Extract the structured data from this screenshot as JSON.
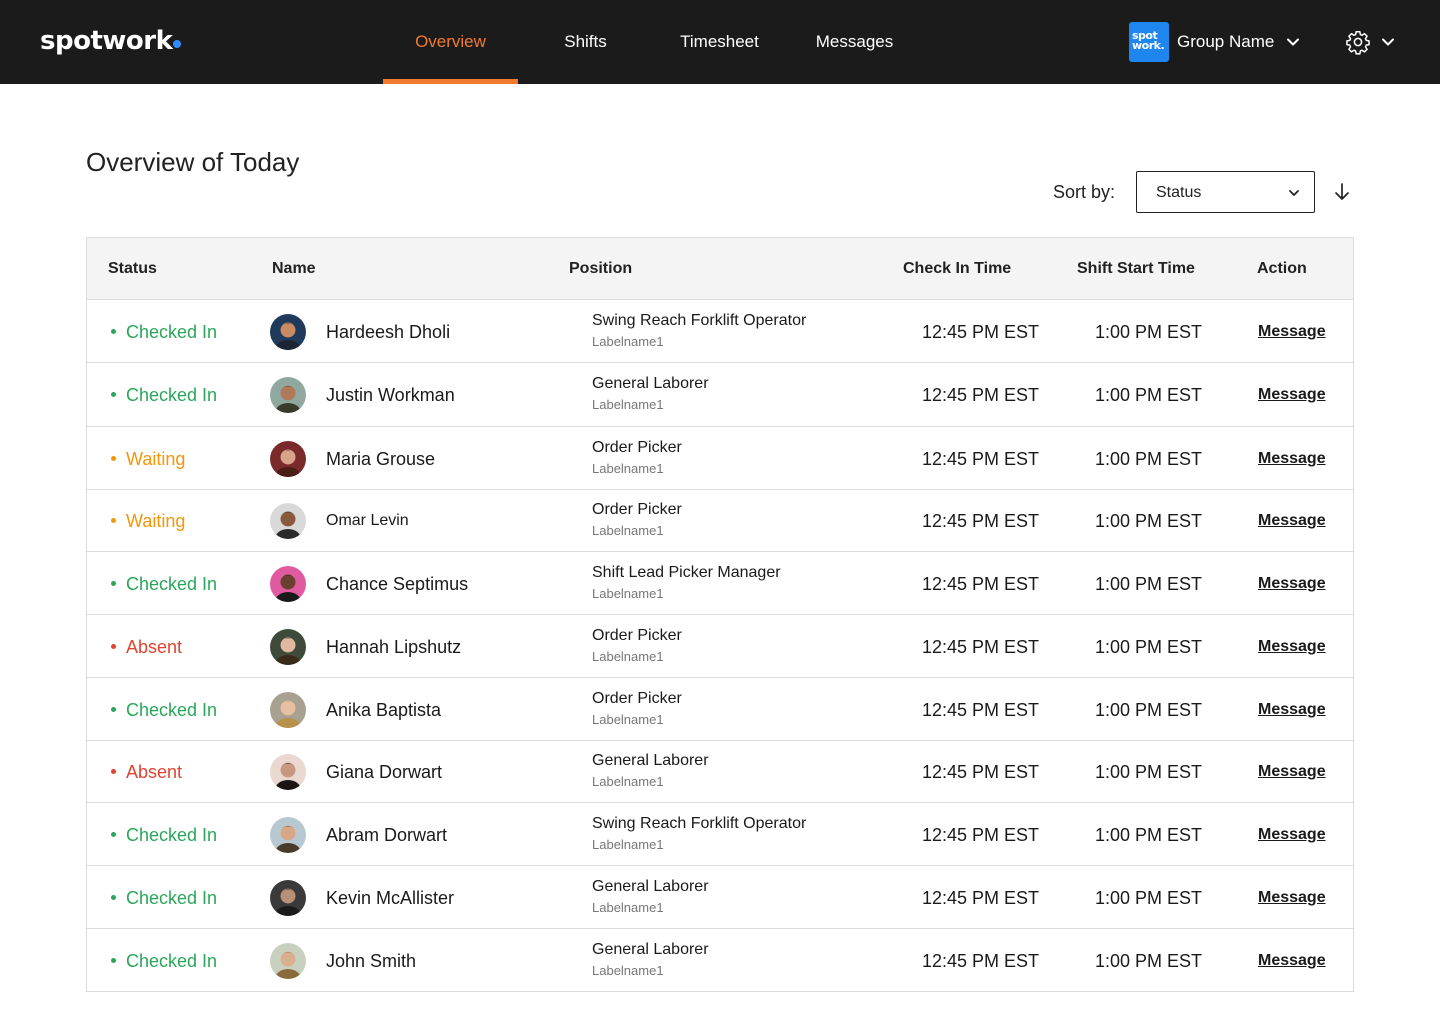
{
  "brand": {
    "logo_text": "spotwork",
    "accent_color": "#f07a2e",
    "logo_dot_color": "#2f8cff"
  },
  "nav": {
    "tabs": [
      {
        "label": "Overview",
        "active": true
      },
      {
        "label": "Shifts",
        "active": false
      },
      {
        "label": "Timesheet",
        "active": false
      },
      {
        "label": "Messages",
        "active": false
      }
    ]
  },
  "group": {
    "logo_line1": "spot",
    "logo_line2": "work.",
    "name": "Group Name",
    "chevron_icon": "chevron-down-icon"
  },
  "settings": {
    "icon": "gear-icon"
  },
  "page": {
    "title": "Overview of Today"
  },
  "sort": {
    "label": "Sort by:",
    "selected": "Status",
    "direction_icon": "arrow-down-icon"
  },
  "table": {
    "headers": {
      "status": "Status",
      "name": "Name",
      "position": "Position",
      "check_in": "Check In Time",
      "shift_start": "Shift Start Time",
      "action": "Action"
    },
    "status_colors": {
      "Checked In": "#2aa65a",
      "Waiting": "#f3960a",
      "Absent": "#e1432f"
    },
    "rows": [
      {
        "status": "Checked In",
        "name": "Hardeesh Dholi",
        "position": "Swing Reach Forklift Operator",
        "label": "Labelname1",
        "check_in": "12:45 PM EST",
        "shift_start": "1:00 PM EST",
        "action": "Message"
      },
      {
        "status": "Checked In",
        "name": "Justin Workman",
        "position": "General Laborer",
        "label": "Labelname1",
        "check_in": "12:45 PM EST",
        "shift_start": "1:00 PM EST",
        "action": "Message"
      },
      {
        "status": "Waiting",
        "name": "Maria Grouse",
        "position": "Order Picker",
        "label": "Labelname1",
        "check_in": "12:45 PM EST",
        "shift_start": "1:00 PM EST",
        "action": "Message"
      },
      {
        "status": "Waiting",
        "name": "Omar Levin",
        "position": "Order Picker",
        "label": "Labelname1",
        "check_in": "12:45 PM EST",
        "shift_start": "1:00 PM EST",
        "action": "Message"
      },
      {
        "status": "Checked In",
        "name": "Chance Septimus",
        "position": "Shift Lead Picker Manager",
        "label": "Labelname1",
        "check_in": "12:45 PM EST",
        "shift_start": "1:00 PM EST",
        "action": "Message"
      },
      {
        "status": "Absent",
        "name": "Hannah Lipshutz",
        "position": "Order Picker",
        "label": "Labelname1",
        "check_in": "12:45 PM EST",
        "shift_start": "1:00 PM EST",
        "action": "Message"
      },
      {
        "status": "Checked In",
        "name": "Anika Baptista",
        "position": "Order Picker",
        "label": "Labelname1",
        "check_in": "12:45 PM EST",
        "shift_start": "1:00 PM EST",
        "action": "Message"
      },
      {
        "status": "Absent",
        "name": "Giana Dorwart",
        "position": "General Laborer",
        "label": "Labelname1",
        "check_in": "12:45 PM EST",
        "shift_start": "1:00 PM EST",
        "action": "Message"
      },
      {
        "status": "Checked In",
        "name": "Abram Dorwart",
        "position": "Swing Reach Forklift Operator",
        "label": "Labelname1",
        "check_in": "12:45 PM EST",
        "shift_start": "1:00 PM EST",
        "action": "Message"
      },
      {
        "status": "Checked In",
        "name": "Kevin McAllister",
        "position": "General Laborer",
        "label": "Labelname1",
        "check_in": "12:45 PM EST",
        "shift_start": "1:00 PM EST",
        "action": "Message"
      },
      {
        "status": "Checked In",
        "name": "John Smith",
        "position": "General Laborer",
        "label": "Labelname1",
        "check_in": "12:45 PM EST",
        "shift_start": "1:00 PM EST",
        "action": "Message"
      }
    ]
  }
}
